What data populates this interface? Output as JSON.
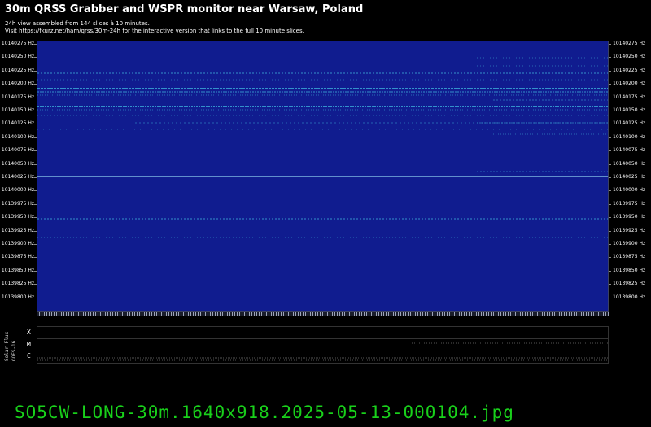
{
  "header": {
    "title": "30m QRSS Grabber and WSPR monitor near Warsaw, Poland",
    "line1": "24h view assembled from 144 slices à 10 minutes.",
    "line2": "Visit https://fkurz.net/ham/qrss/30m-24h for the interactive version that links to the full 10 minute slices."
  },
  "spectrogram": {
    "frequency_labels": [
      "10140275 Hz",
      "10140250 Hz",
      "10140225 Hz",
      "10140200 Hz",
      "10140175 Hz",
      "10140150 Hz",
      "10140125 Hz",
      "10140100 Hz",
      "10140075 Hz",
      "10140050 Hz",
      "10140025 Hz",
      "10140000 Hz",
      "10139975 Hz",
      "10139950 Hz",
      "10139925 Hz",
      "10139900 Hz",
      "10139875 Hz",
      "10139850 Hz",
      "10139825 Hz",
      "10139800 Hz"
    ],
    "background_color": "#101c8f",
    "signal_color": "#39a7d8"
  },
  "flux": {
    "side_label_1": "Solar Flux",
    "side_label_2": "GOES-16",
    "levels": [
      "X",
      "M",
      "C"
    ]
  },
  "footer": {
    "filename": "SO5CW-LONG-30m.1640x918.2025-05-13-000104.jpg"
  }
}
